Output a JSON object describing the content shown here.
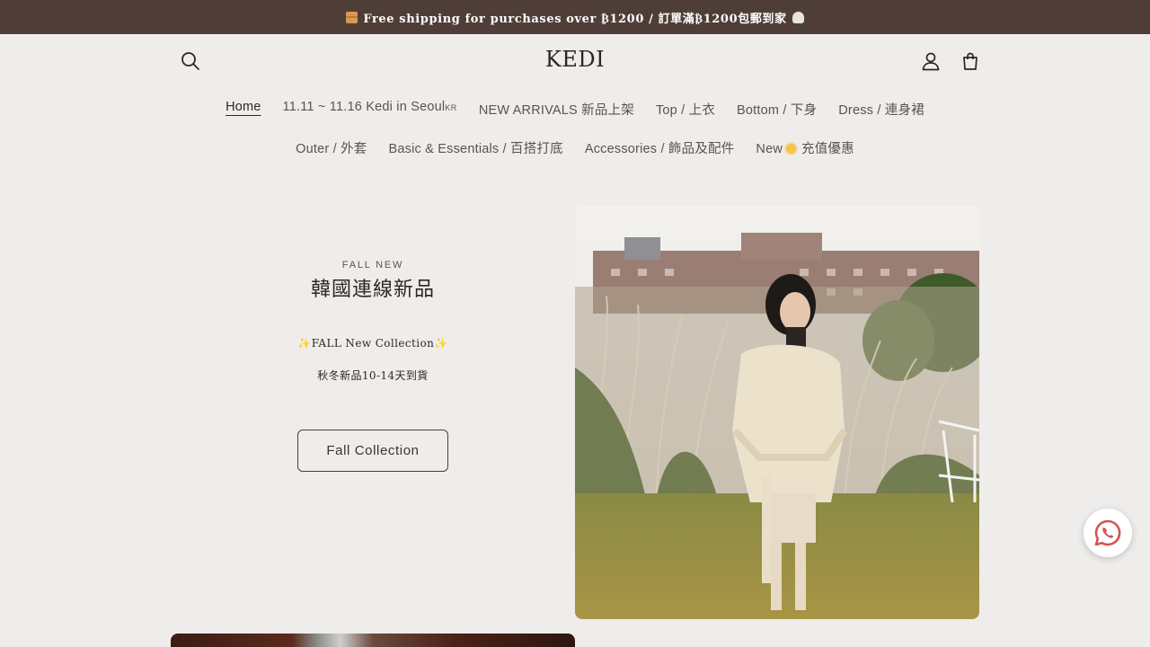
{
  "announcement": {
    "text": "Free shipping for purchases over ₿1200 / 訂單滿₿1200包郵到家",
    "left_icon": "package-icon",
    "right_icon": "house-icon"
  },
  "header": {
    "logo": "KEDI",
    "search_icon": "search-icon",
    "account_icon": "account-icon",
    "cart_icon": "cart-icon"
  },
  "nav": {
    "row1": [
      {
        "label": "Home",
        "active": true
      },
      {
        "label": "11.11 ~ 11.16 Kedi in Seoul",
        "suffix": "KR"
      },
      {
        "label": "NEW ARRIVALS 新品上架"
      },
      {
        "label": "Top / 上衣"
      },
      {
        "label": "Bottom / 下身"
      },
      {
        "label": "Dress / 連身裙"
      }
    ],
    "row2": [
      {
        "label": "Outer / 外套"
      },
      {
        "label": "Basic & Essentials  / 百搭打底"
      },
      {
        "label": "Accessories / 飾品及配件"
      },
      {
        "label": "New",
        "suffix": "充值優惠"
      }
    ]
  },
  "hero": {
    "eyebrow": "FALL NEW",
    "title": "韓國連線新品",
    "line1": "FALL New Collection",
    "line2": "秋冬新品10-14天到貨",
    "button": "Fall Collection"
  },
  "floating": {
    "whatsapp_icon": "whatsapp-icon"
  },
  "colors": {
    "announcement_bg": "#4f3e38",
    "page_bg": "#efedeb",
    "text": "#3a3330"
  }
}
